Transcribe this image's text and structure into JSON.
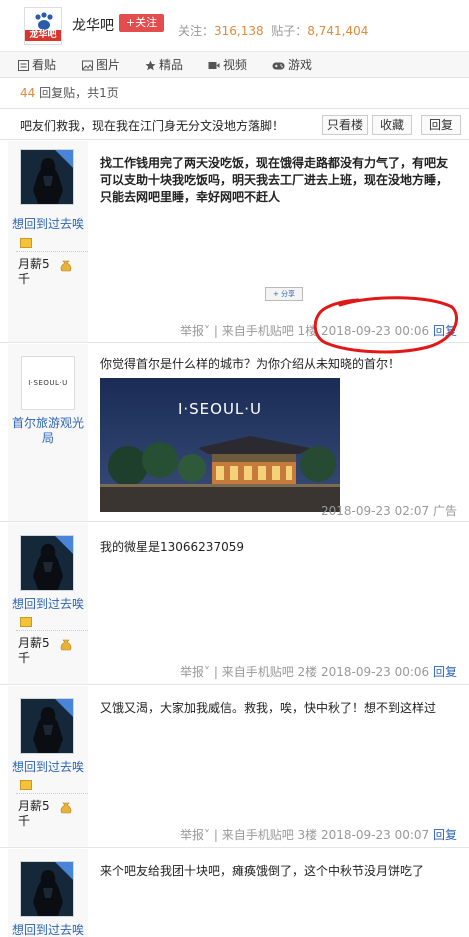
{
  "header": {
    "logo_text": "龙华吧",
    "forum_name": "龙华吧",
    "follow_label": "+关注",
    "follow_prefix": "关注：",
    "follow_count": "316,138",
    "posts_prefix": "贴子：",
    "posts_count": "8,741,404"
  },
  "tabs": [
    {
      "label": "看贴",
      "icon": "list-icon"
    },
    {
      "label": "图片",
      "icon": "image-icon"
    },
    {
      "label": "精品",
      "icon": "star-icon"
    },
    {
      "label": "视频",
      "icon": "video-icon"
    },
    {
      "label": "游戏",
      "icon": "gamepad-icon"
    }
  ],
  "reply_info": {
    "count": "44",
    "suffix": "回复贴，共1页"
  },
  "thread": {
    "title": "吧友们救我，现在我在江门身无分文没地方落脚！",
    "buttons": [
      "只看楼主",
      "收藏",
      "回复"
    ]
  },
  "user": {
    "name": "想回到过去唉",
    "salary": "月薪5千"
  },
  "posts": [
    {
      "content": "找工作钱用完了两天没吃饭，现在饿得走路都没有力气了，有吧友可以支助十块我吃饭吗，明天我去工厂进去上班，现在没地方睡，只能去网吧里睡，幸好网吧不赶人",
      "share": "分享",
      "report": "举报",
      "source": "来自手机贴吧",
      "floor": "1楼",
      "time": "2018-09-23 00:06",
      "reply": "回复"
    },
    {
      "content": "我的微星是13066237059",
      "report": "举报",
      "source": "来自手机贴吧",
      "floor": "2楼",
      "time": "2018-09-23 00:06",
      "reply": "回复"
    },
    {
      "content": "又饿又渴，大家加我威信。救我，唉，快中秋了！想不到这样过",
      "report": "举报",
      "source": "来自手机贴吧",
      "floor": "3楼",
      "time": "2018-09-23 00:07",
      "reply": "回复"
    },
    {
      "content": "来个吧友给我团十块吧，瘫痪饿倒了，这个中秋节没月饼吃了"
    }
  ],
  "ad": {
    "logo_text": "I·SEOUL·U",
    "name": "首尔旅游观光局",
    "content": "你觉得首尔是什么样的城市？为你介绍从未知晓的首尔！",
    "image_text": "I·SEOUL·U",
    "time": "2018-09-23 02:07",
    "label": "广告"
  },
  "colors": {
    "accent": "#2d64b3",
    "follow": "#e34d4d",
    "count": "#e08a3c",
    "annotation": "#e01818"
  }
}
